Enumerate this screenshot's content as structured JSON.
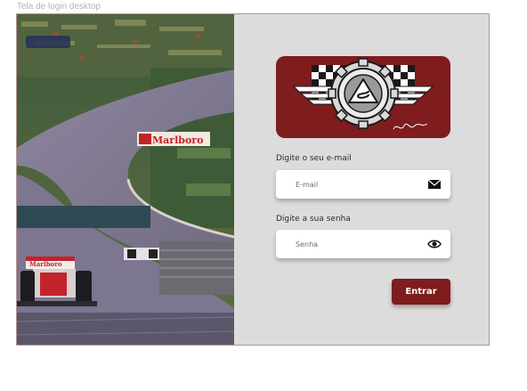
{
  "frame": {
    "title": "Tela de login desktop"
  },
  "hero": {
    "banner_text": "Marlboro",
    "car_livery_text": "Marlboro"
  },
  "logo": {
    "icons": [
      "gear-icon",
      "checkered-flag-icon",
      "wing-icon",
      "senna-s-icon"
    ],
    "signature_text": "Ayrton Senna"
  },
  "form": {
    "email_label": "Digite o seu e-mail",
    "email_placeholder": "E-mail",
    "email_icon": "envelope-icon",
    "password_label": "Digite a sua senha",
    "password_placeholder": "Senha",
    "password_icon": "eye-icon",
    "submit_label": "Entrar"
  },
  "colors": {
    "brand": "#7e1c1e",
    "panel": "#dcdcdc",
    "field": "#ffffff"
  }
}
